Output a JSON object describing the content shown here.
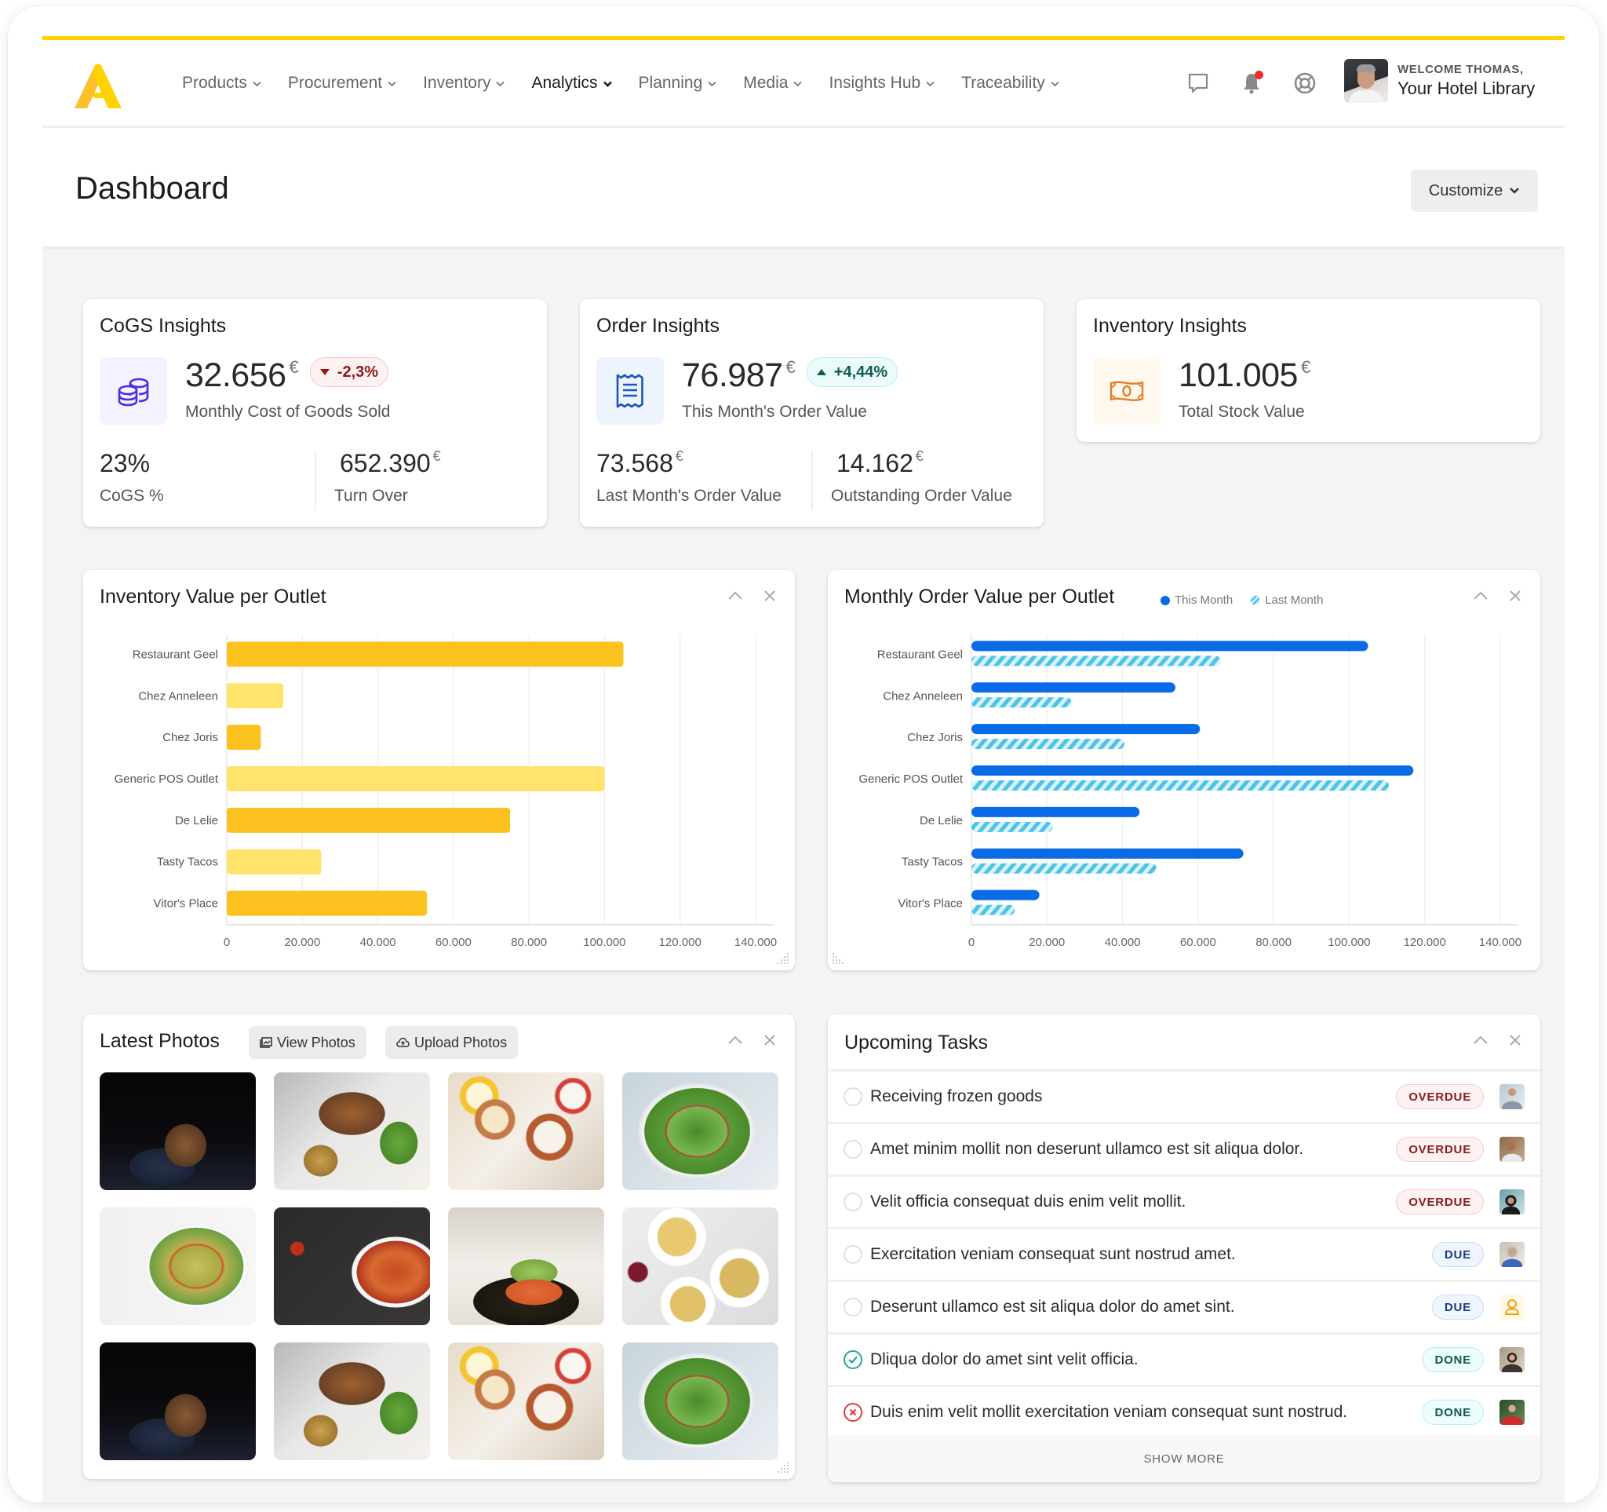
{
  "app": {
    "brand_color": "#FFD200",
    "nav": {
      "items": [
        {
          "label": "Products",
          "active": false
        },
        {
          "label": "Procurement",
          "active": false
        },
        {
          "label": "Inventory",
          "active": false
        },
        {
          "label": "Analytics",
          "active": true
        },
        {
          "label": "Planning",
          "active": false
        },
        {
          "label": "Media",
          "active": false
        },
        {
          "label": "Insights Hub",
          "active": false
        },
        {
          "label": "Traceability",
          "active": false
        }
      ],
      "icons": [
        "chat-icon",
        "bell-icon",
        "support-lifebuoy-icon"
      ],
      "has_notification": true
    },
    "user": {
      "welcome": "WELCOME THOMAS,",
      "library": "Your Hotel Library"
    }
  },
  "header": {
    "title": "Dashboard",
    "customize_label": "Customize"
  },
  "kpis": {
    "cogs": {
      "title": "CoGS Insights",
      "icon": "coins-stack-icon",
      "value": "32.656",
      "currency": "€",
      "change": "-2,3%",
      "change_direction": "down",
      "label": "Monthly Cost of Goods Sold",
      "sub": [
        {
          "value": "23%",
          "currency": "",
          "label": "CoGS %"
        },
        {
          "value": "652.390",
          "currency": "€",
          "label": "Turn Over"
        }
      ]
    },
    "orders": {
      "title": "Order Insights",
      "icon": "receipt-icon",
      "value": "76.987",
      "currency": "€",
      "change": "+4,44%",
      "change_direction": "up",
      "label": "This Month's Order Value",
      "sub": [
        {
          "value": "73.568",
          "currency": "€",
          "label": "Last Month's Order Value"
        },
        {
          "value": "14.162",
          "currency": "€",
          "label": "Outstanding Order Value"
        }
      ]
    },
    "inventory": {
      "title": "Inventory Insights",
      "icon": "banknote-icon",
      "value": "101.005",
      "currency": "€",
      "label": "Total Stock Value"
    }
  },
  "chart_data": [
    {
      "type": "bar",
      "orientation": "horizontal",
      "title": "Inventory Value per Outlet",
      "categories": [
        "Restaurant Geel",
        "Chez Anneleen",
        "Chez Joris",
        "Generic POS Outlet",
        "De Lelie",
        "Tasty Tacos",
        "Vitor's Place"
      ],
      "values": [
        105000,
        15000,
        9000,
        100000,
        75000,
        25000,
        53000
      ],
      "colors": [
        "#FCC21F",
        "#FFE36B",
        "#FCC21F",
        "#FFE36B",
        "#FCC21F",
        "#FFE36B",
        "#FCC21F"
      ],
      "xlim": [
        0,
        140000
      ],
      "xticks": [
        0,
        20000,
        40000,
        60000,
        80000,
        100000,
        120000,
        140000
      ],
      "xtick_labels": [
        "0",
        "20.000",
        "40.000",
        "60.000",
        "80.000",
        "100.000",
        "120.000",
        "140.000"
      ],
      "xlabel": "",
      "ylabel": "",
      "grid": true,
      "legend": "none"
    },
    {
      "type": "bar",
      "orientation": "horizontal",
      "title": "Monthly Order Value per Outlet",
      "categories": [
        "Restaurant Geel",
        "Chez Anneleen",
        "Chez Joris",
        "Generic POS Outlet",
        "De Lelie",
        "Tasty Tacos",
        "Vitor's Place"
      ],
      "series": [
        {
          "name": "This Month",
          "color": "#0A6BE6",
          "pattern": "solid",
          "values": [
            105000,
            54000,
            60500,
            117000,
            44500,
            72000,
            18000
          ]
        },
        {
          "name": "Last Month",
          "color": "#4EC3EA",
          "pattern": "hatched",
          "values": [
            66000,
            26500,
            40500,
            110500,
            21500,
            49000,
            11500
          ]
        }
      ],
      "xlim": [
        0,
        140000
      ],
      "xticks": [
        0,
        20000,
        40000,
        60000,
        80000,
        100000,
        120000,
        140000
      ],
      "xtick_labels": [
        "0",
        "20.000",
        "40.000",
        "60.000",
        "80.000",
        "100.000",
        "120.000",
        "140.000"
      ],
      "xlabel": "",
      "ylabel": "",
      "grid": true,
      "legend": "top-left"
    }
  ],
  "photos": {
    "title": "Latest Photos",
    "view_label": "View Photos",
    "upload_label": "Upload Photos",
    "items": [
      {
        "subject": "burger-on-skewer"
      },
      {
        "subject": "grilled-pork-chop"
      },
      {
        "subject": "breakfast-table-waffles"
      },
      {
        "subject": "green-salad-bowl"
      },
      {
        "subject": "farfalle-pasta-salad"
      },
      {
        "subject": "red-curry-bowl"
      },
      {
        "subject": "salmon-fillet"
      },
      {
        "subject": "spaghetti-plates"
      },
      {
        "subject": "burger-on-skewer"
      },
      {
        "subject": "grilled-pork-chop"
      },
      {
        "subject": "breakfast-table-waffles"
      },
      {
        "subject": "green-salad-bowl"
      }
    ]
  },
  "tasks": {
    "title": "Upcoming Tasks",
    "show_more": "SHOW MORE",
    "items": [
      {
        "text": "Receiving frozen goods",
        "status": "OVERDUE",
        "state": "open",
        "assignee": "avatar-man-grey-shirt"
      },
      {
        "text": "Amet minim mollit non deserunt ullamco est sit aliqua dolor.",
        "status": "OVERDUE",
        "state": "open",
        "assignee": "avatar-man-beard"
      },
      {
        "text": "Velit officia consequat duis enim velit mollit.",
        "status": "OVERDUE",
        "state": "open",
        "assignee": "avatar-woman-dark-hair"
      },
      {
        "text": "Exercitation veniam consequat sunt nostrud amet.",
        "status": "DUE",
        "state": "open",
        "assignee": "avatar-woman-grey-hair"
      },
      {
        "text": "Deserunt ullamco est sit aliqua dolor do amet sint.",
        "status": "DUE",
        "state": "open",
        "assignee": "avatar-placeholder"
      },
      {
        "text": "Dliqua dolor do amet sint velit officia.",
        "status": "DONE",
        "state": "completed",
        "assignee": "avatar-woman-short-hair"
      },
      {
        "text": "Duis enim velit mollit exercitation veniam consequat sunt nostrud.",
        "status": "DONE",
        "state": "failed",
        "assignee": "avatar-man-red-shirt"
      }
    ]
  }
}
